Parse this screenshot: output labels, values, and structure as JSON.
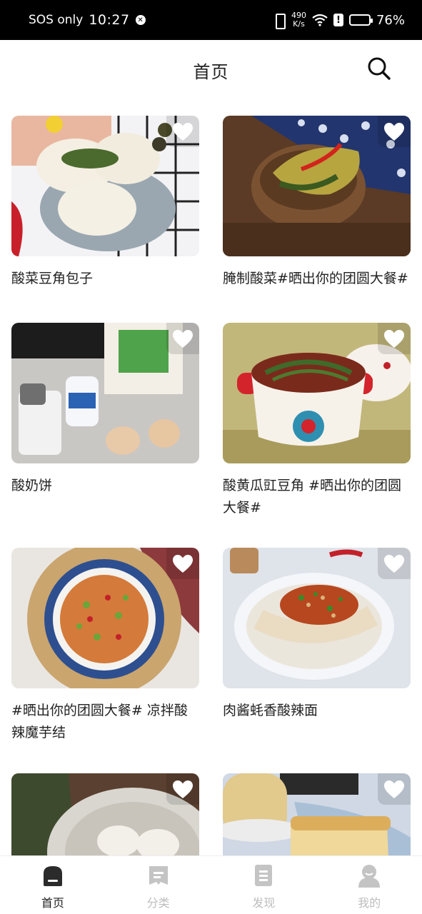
{
  "status_bar": {
    "carrier": "SOS only",
    "time": "10:27",
    "net_speed_value": "490",
    "net_speed_unit": "K/s",
    "battery": "76%",
    "battery_level": 0.76
  },
  "header": {
    "title": "首页"
  },
  "recipes": [
    {
      "title": "酸菜豆角包子"
    },
    {
      "title": "腌制酸菜#晒出你的团圆大餐#"
    },
    {
      "title": "酸奶饼"
    },
    {
      "title": "酸黄瓜豇豆角 #晒出你的团圆大餐#"
    },
    {
      "title": "#晒出你的团圆大餐# 凉拌酸辣魔芋结"
    },
    {
      "title": "肉酱蚝香酸辣面"
    },
    {
      "title": ""
    },
    {
      "title": ""
    }
  ],
  "bottom_nav": {
    "items": [
      {
        "label": "首页",
        "icon": "home-icon",
        "active": true
      },
      {
        "label": "分类",
        "icon": "category-icon",
        "active": false
      },
      {
        "label": "发现",
        "icon": "discover-icon",
        "active": false
      },
      {
        "label": "我的",
        "icon": "profile-icon",
        "active": false
      }
    ]
  },
  "colors": {
    "status_bar_bg": "#000000",
    "active_label": "#222222",
    "inactive": "#bdbdbd"
  }
}
